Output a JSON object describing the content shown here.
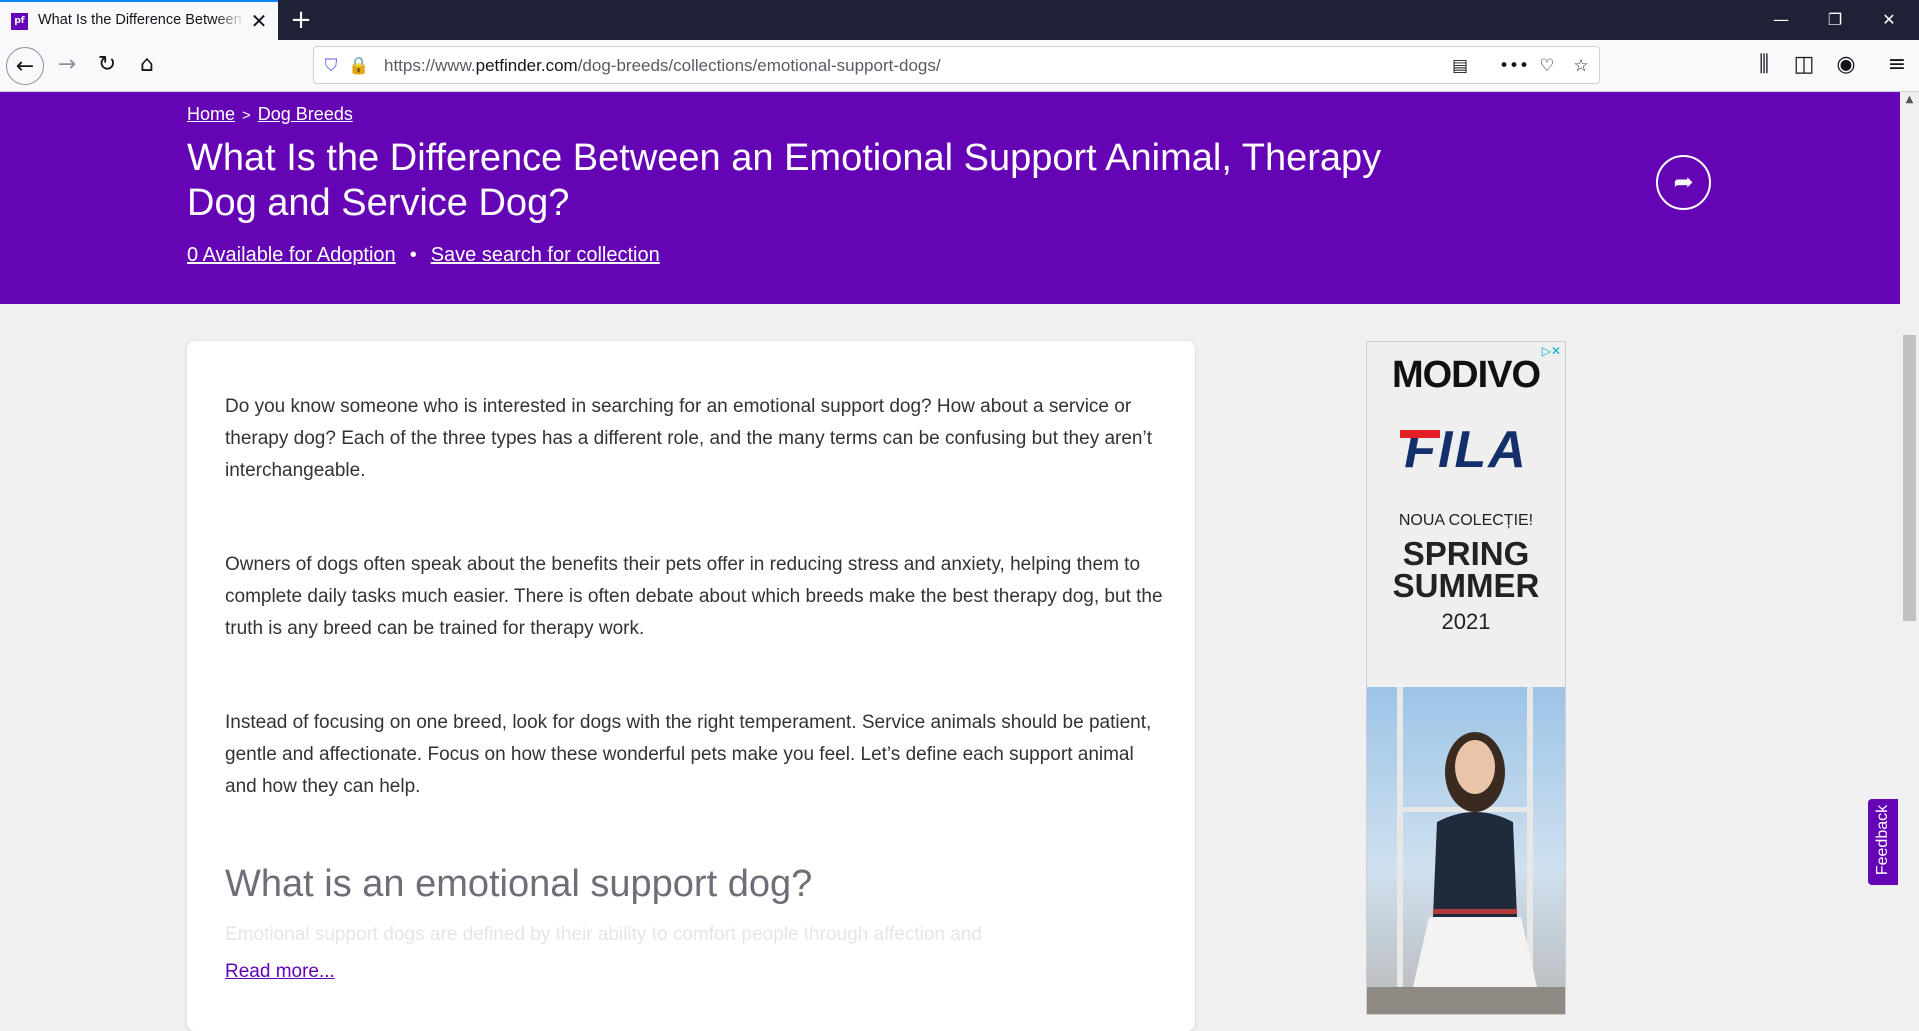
{
  "browser": {
    "tab_title": "What Is the Difference Between",
    "favicon_label": "pf",
    "url_prefix": "https://www.",
    "url_domain": "petfinder.com",
    "url_path": "/dog-breeds/collections/emotional-support-dogs/"
  },
  "breadcrumb": {
    "home": "Home",
    "separator": ">",
    "dog_breeds": "Dog Breeds"
  },
  "hero": {
    "title": "What Is the Difference Between an Emotional Support Animal, Therapy Dog and Service Dog?",
    "available_link": "0 Available for Adoption",
    "dot": "•",
    "save_link": "Save search for collection"
  },
  "article": {
    "paragraphs": [
      "Do you know someone who is interested in searching for an emotional support dog? How about a service or therapy dog? Each of the three types has a different role, and the many terms can be confusing but they aren’t interchangeable.",
      "Owners of dogs often speak about the benefits their pets offer in reducing stress and anxiety, helping them to complete daily tasks much easier. There is often debate about which breeds make the best therapy dog, but the truth is any breed can be trained for therapy work.",
      "Instead of focusing on one breed, look for dogs with the right temperament. Service animals should be patient, gentle and affectionate. Focus on how these wonderful pets make you feel. Let’s define each support animal and how they can help."
    ],
    "section_heading": "What is an emotional support dog?",
    "teaser": "Emotional support dogs are defined by their ability to comfort people through affection and",
    "read_more": "Read more..."
  },
  "ad": {
    "brand": "MODIVO",
    "sub_brand": "FILA",
    "tagline": "NOUA COLECȚIE!",
    "season_line1": "SPRING",
    "season_line2": "SUMMER",
    "year": "2021"
  },
  "feedback": {
    "label": "Feedback"
  }
}
